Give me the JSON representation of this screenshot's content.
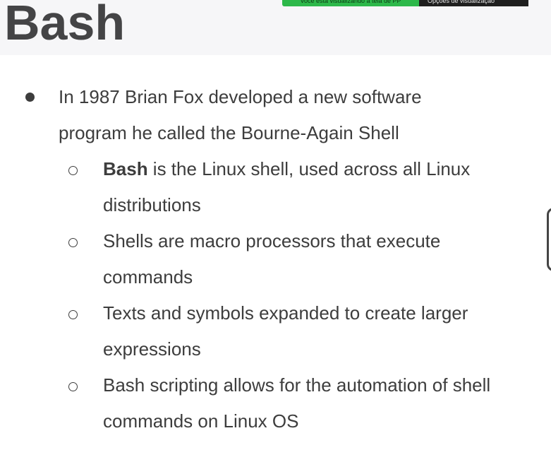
{
  "slide": {
    "title": "Bash"
  },
  "share_bar": {
    "status_text": "Você está visualizando a tela de PP",
    "options_label": "Opções de visualização",
    "status_color": "#2db84a"
  },
  "bullets": [
    {
      "level": 1,
      "text": "In 1987 Brian Fox developed a new software program he called the Bourne-Again Shell"
    },
    {
      "level": 2,
      "bold_prefix": "Bash",
      "text": " is the Linux shell, used across all Linux distributions"
    },
    {
      "level": 2,
      "text": "Shells are macro processors that execute commands"
    },
    {
      "level": 2,
      "text": "Texts and symbols expanded to create larger expressions"
    },
    {
      "level": 2,
      "text": "Bash scripting allows for the automation of shell commands on Linux OS"
    }
  ]
}
